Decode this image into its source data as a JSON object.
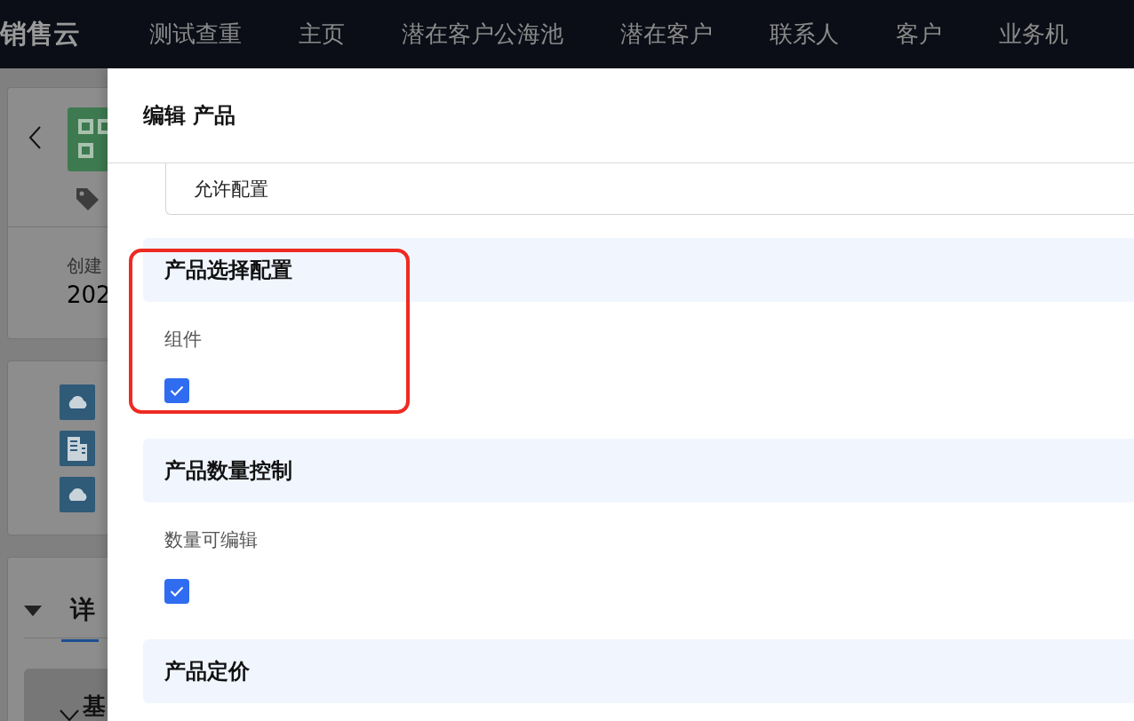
{
  "nav": {
    "brand": "销售云",
    "items": [
      {
        "label": "测试查重"
      },
      {
        "label": "主页"
      },
      {
        "label": "潜在客户公海池"
      },
      {
        "label": "潜在客户"
      },
      {
        "label": "联系人"
      },
      {
        "label": "客户"
      },
      {
        "label": "业务机"
      }
    ]
  },
  "background": {
    "created_label": "创建",
    "created_value": "202",
    "tab_label": "详",
    "section_label": "基"
  },
  "modal": {
    "title": "编辑 产品",
    "field_value": "允许配置",
    "sections": [
      {
        "title": "产品选择配置",
        "highlighted": true,
        "fields": [
          {
            "label": "组件",
            "checked": true
          }
        ]
      },
      {
        "title": "产品数量控制",
        "fields": [
          {
            "label": "数量可编辑",
            "checked": true
          }
        ]
      },
      {
        "title": "产品定价"
      }
    ]
  }
}
